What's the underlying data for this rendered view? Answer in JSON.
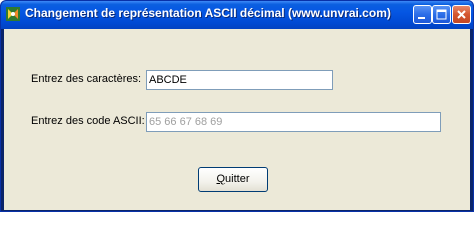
{
  "window": {
    "title": "Changement de représentation ASCII décimal   (www.unvrai.com)"
  },
  "titlebar_icons": {
    "app": "app-icon",
    "minimize": "minimize-icon",
    "maximize": "maximize-icon",
    "close": "close-icon"
  },
  "form": {
    "chars_label": "Entrez des caractères:",
    "chars_value": "ABCDE",
    "ascii_label": "Entrez des code ASCII:",
    "ascii_value": "65 66 67 68 69"
  },
  "buttons": {
    "quit_first": "Q",
    "quit_rest": "uitter"
  },
  "colors": {
    "titlebar": "#0556e3",
    "client": "#ece9d8",
    "close_button": "#d4562f"
  }
}
